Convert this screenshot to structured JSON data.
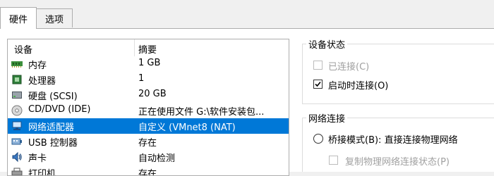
{
  "tabs": [
    {
      "label": "硬件"
    },
    {
      "label": "选项"
    }
  ],
  "device_list": {
    "columns": {
      "device": "设备",
      "summary": "摘要"
    },
    "rows": [
      {
        "icon": "memory-icon",
        "name": "内存",
        "summary": "1 GB"
      },
      {
        "icon": "processor-icon",
        "name": "处理器",
        "summary": "1"
      },
      {
        "icon": "hard-disk-icon",
        "name": "硬盘 (SCSI)",
        "summary": "20 GB"
      },
      {
        "icon": "cd-dvd-icon",
        "name": "CD/DVD (IDE)",
        "summary": "正在使用文件 G:\\软件安装包..."
      },
      {
        "icon": "network-adapter-icon",
        "name": "网络适配器",
        "summary": "自定义 (VMnet8 (NAT)",
        "selected": true
      },
      {
        "icon": "usb-icon",
        "name": "USB 控制器",
        "summary": "存在"
      },
      {
        "icon": "sound-card-icon",
        "name": "声卡",
        "summary": "自动检测"
      },
      {
        "icon": "printer-icon",
        "name": "打印机",
        "summary": "存在"
      }
    ]
  },
  "device_status": {
    "title": "设备状态",
    "connected": {
      "label": "已连接(C)",
      "checked": false,
      "enabled": false
    },
    "connect_at_power_on": {
      "label": "启动时连接(O)",
      "checked": true,
      "enabled": true
    }
  },
  "network_connection": {
    "title": "网络连接",
    "bridged": {
      "label": "桥接模式(B): 直接连接物理网络",
      "selected": false
    },
    "replicate": {
      "label": "复制物理网络连接状态(P)",
      "checked": false,
      "enabled": false
    }
  },
  "colors": {
    "selection": "#0078d7",
    "border": "#adadad"
  }
}
